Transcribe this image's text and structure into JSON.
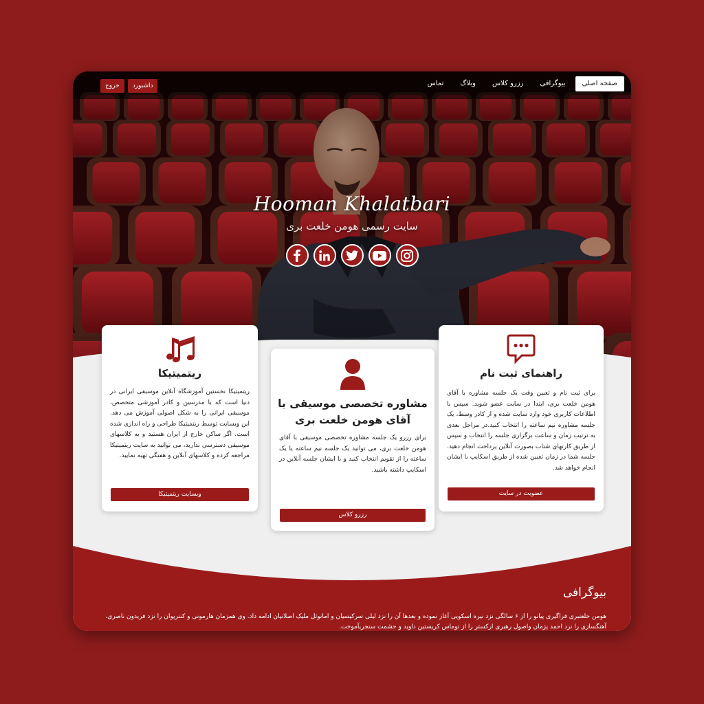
{
  "nav": {
    "items": [
      {
        "label": "صفحه اصلی",
        "active": true
      },
      {
        "label": "بیوگرافی"
      },
      {
        "label": "رزرو کلاس"
      },
      {
        "label": "وبلاگ"
      },
      {
        "label": "تماس"
      }
    ],
    "dashboard_label": "داشبورد",
    "logout_label": "خروج"
  },
  "hero": {
    "name": "Hooman Khalatbari",
    "subtitle": "سایت رسمی هومن خلعت بری",
    "socials": [
      "facebook-icon",
      "linkedin-icon",
      "twitter-icon",
      "youtube-icon",
      "instagram-icon"
    ]
  },
  "cards": {
    "left": {
      "icon": "music-notes-icon",
      "title": "ریتمیتیکا",
      "body": "ریتمیتیکا نخستین آموزشگاه آنلاین موسیقی ایرانی در دنیا است که با مدرسین و کادر آموزشی متخصص، موسیقی ایرانی را به شکل اصولی آموزش می دهد. این وبسایت توسط ریتمیتیکا طراحی و راه اندازی شده است. اگر ساکن خارج از ایران هستید و به کلاسهای موسیقی دسترسی ندارید، می توانید به سایت ریتمیتیکا مراجعه کرده و کلاسهای آنلاین و هفتگی تهیه نمایید.",
      "button": "وبسایت ریتمیتیکا"
    },
    "middle": {
      "icon": "user-icon",
      "title_line1": "مشاوره تخصصی موسیقی با",
      "title_line2": "آقای هومن خلعت بری",
      "body": "برای رزرو یک جلسه مشاوره تخصصی موسیقی با آقای هومن خلعت بری، می توانید یک جلسه نیم ساعته یا یک ساعته را از تقویم انتخاب کنید و با ایشان جلسه آنلاین در اسکایپ داشته باشید.",
      "button": "رزرو کلاس"
    },
    "right": {
      "icon": "chat-bubble-icon",
      "title": "راهنمای ثبت نام",
      "body": "برای ثبت نام و تعیین وقت یک جلسه مشاوره با آقای هومن خلعت بری، ابتدا در سایت عضو شوید. سپس با اطلاعات کاربری خود وارد سایت شده و از کادر وسط، یک جلسه مشاوره نیم ساعته را انتخاب کنید.در مراحل بعدی به ترتیب زمان و ساعت برگزاری جلسه را انتخاب و سپس از طریق کارتهای شتاب بصورت آنلاین پرداخت انجام دهید. جلسه شما در زمان تعیین شده از طریق اسکایپ با ایشان انجام خواهد شد.",
      "button": "عضویت در سایت"
    }
  },
  "bio": {
    "title": "بیوگرافی",
    "text": "هومن خلعتبری فراگیری پیانو را از ۶ سالگی نزد نیره اسکویی آغاز نموده و بعدها آن را نزد لیلی سرکیسیان و امانوئل ملیک اصلانیان ادامه داد. وی همزمان هارمونی و کنترپوان را نزد فریدون ناصری، آهنگسازی را نزد احمد پژمان واصول رهبری ارکستر را از توماس کریستین داوید و حشمت سنجریآموخت."
  },
  "colors": {
    "accent": "#9b1b1b",
    "page_bg": "#8f1c1c",
    "section_bg": "#efefef"
  }
}
